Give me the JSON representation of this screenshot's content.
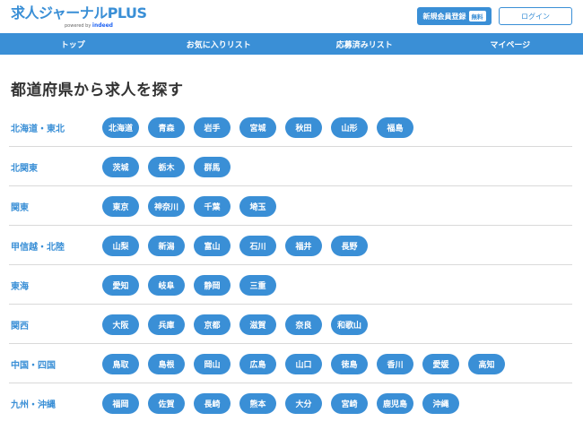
{
  "header": {
    "logo": "求人ジャーナルPLUS",
    "logo_sub_prefix": "powered by",
    "logo_sub_brand": "indeed",
    "register_label": "新規会員登録",
    "register_badge": "無料",
    "login_label": "ログイン"
  },
  "nav": {
    "items": [
      {
        "label": "トップ"
      },
      {
        "label": "お気に入りリスト"
      },
      {
        "label": "応募済みリスト"
      },
      {
        "label": "マイページ"
      }
    ]
  },
  "main": {
    "title": "都道府県から求人を探す",
    "regions": [
      {
        "name": "北海道・東北",
        "prefectures": [
          "北海道",
          "青森",
          "岩手",
          "宮城",
          "秋田",
          "山形",
          "福島"
        ]
      },
      {
        "name": "北関東",
        "prefectures": [
          "茨城",
          "栃木",
          "群馬"
        ]
      },
      {
        "name": "関東",
        "prefectures": [
          "東京",
          "神奈川",
          "千葉",
          "埼玉"
        ]
      },
      {
        "name": "甲信越・北陸",
        "prefectures": [
          "山梨",
          "新潟",
          "富山",
          "石川",
          "福井",
          "長野"
        ]
      },
      {
        "name": "東海",
        "prefectures": [
          "愛知",
          "岐阜",
          "静岡",
          "三重"
        ]
      },
      {
        "name": "関西",
        "prefectures": [
          "大阪",
          "兵庫",
          "京都",
          "滋賀",
          "奈良",
          "和歌山"
        ]
      },
      {
        "name": "中国・四国",
        "prefectures": [
          "鳥取",
          "島根",
          "岡山",
          "広島",
          "山口",
          "徳島",
          "香川",
          "愛媛",
          "高知"
        ]
      },
      {
        "name": "九州・沖縄",
        "prefectures": [
          "福岡",
          "佐賀",
          "長崎",
          "熊本",
          "大分",
          "宮崎",
          "鹿児島",
          "沖縄"
        ]
      }
    ]
  },
  "colors": {
    "accent": "#3a8fd6",
    "divider": "#d9d9d9",
    "text": "#333333"
  }
}
